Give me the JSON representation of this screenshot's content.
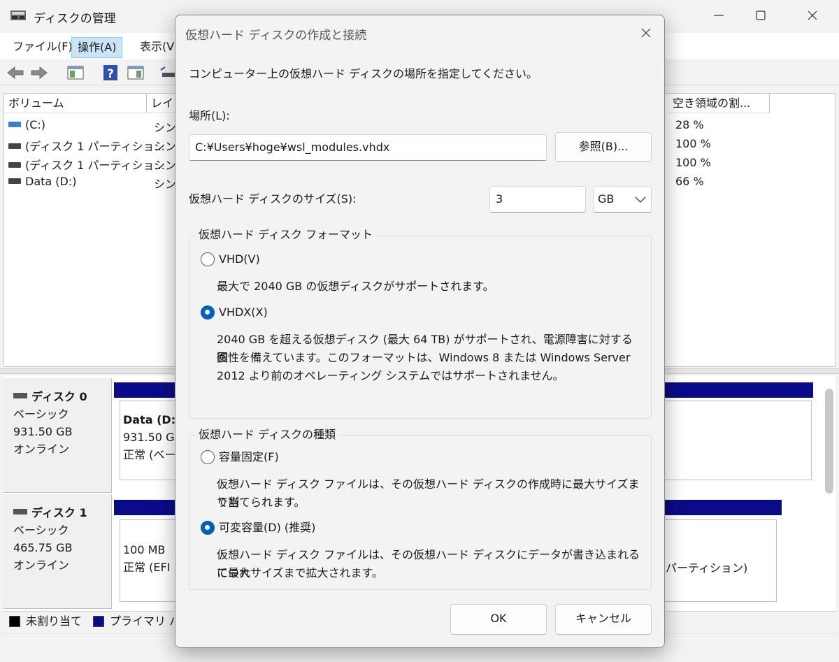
{
  "window": {
    "title": "ディスクの管理"
  },
  "menu": {
    "items": [
      "ファイル(F)",
      "操作(A)",
      "表示(V"
    ]
  },
  "volumes": {
    "headers": [
      "ボリューム",
      "レイ",
      "空き領域の割..."
    ],
    "rows": [
      {
        "name": "(C:)",
        "layout": "シン",
        "free": "28 %"
      },
      {
        "name": "(ディスク 1 パーティショ...",
        "layout": "シン",
        "free": "100 %"
      },
      {
        "name": "(ディスク 1 パーティショ...",
        "layout": "シン",
        "free": "100 %"
      },
      {
        "name": "Data (D:)",
        "layout": "シン",
        "free": "66 %"
      }
    ]
  },
  "disks": [
    {
      "name": "ディスク 0",
      "type": "ベーシック",
      "size": "931.50 GB",
      "state": "オンライン",
      "partition": {
        "line1": "Data  (D:",
        "line2": "931.50 G",
        "line3": "正常 (ベー"
      }
    },
    {
      "name": "ディスク 1",
      "type": "ベーシック",
      "size": "465.75 GB",
      "state": "オンライン",
      "partition": {
        "line1": "100 MB",
        "line2": "正常 (EFI"
      },
      "partition_right": {
        "line1": "パーティション)"
      }
    }
  ],
  "legend": {
    "unallocated": "未割り当て",
    "primary": "プライマリ パー"
  },
  "dialog": {
    "title": "仮想ハード ディスクの作成と接続",
    "instruction": "コンピューター上の仮想ハード ディスクの場所を指定してください。",
    "location_label": "場所(L):",
    "location_value": "C:¥Users¥hoge¥wsl_modules.vhdx",
    "browse_label": "参照(B)...",
    "size_label": "仮想ハード ディスクのサイズ(S):",
    "size_value": "3",
    "size_unit": "GB",
    "format_group": {
      "title": "仮想ハード ディスク フォーマット",
      "vhd_label": "VHD(V)",
      "vhd_desc": "最大で 2040 GB の仮想ディスクがサポートされます。",
      "vhdx_label": "VHDX(X)",
      "vhdx_desc1": "2040 GB を超える仮想ディスク (最大 64 TB) がサポートされ、電源障害に対する回",
      "vhdx_desc2": "復性を備えています。このフォーマットは、Windows 8 または Windows Server",
      "vhdx_desc3": "2012 より前のオペレーティング システムではサポートされません。",
      "selected": "VHDX(X)"
    },
    "type_group": {
      "title": "仮想ハード ディスクの種類",
      "fixed_label": "容量固定(F)",
      "fixed_desc1": "仮想ハード ディスク ファイルは、その仮想ハード ディスクの作成時に最大サイズまで割",
      "fixed_desc2": "り当てられます。",
      "dynamic_label": "可変容量(D) (推奨)",
      "dynamic_desc1": "仮想ハード ディスク ファイルは、その仮想ハード ディスクにデータが書き込まれるにつれ",
      "dynamic_desc2": "て最大サイズまで拡大されます。",
      "selected": "可変容量(D) (推奨)"
    },
    "ok_label": "OK",
    "cancel_label": "キャンセル"
  }
}
